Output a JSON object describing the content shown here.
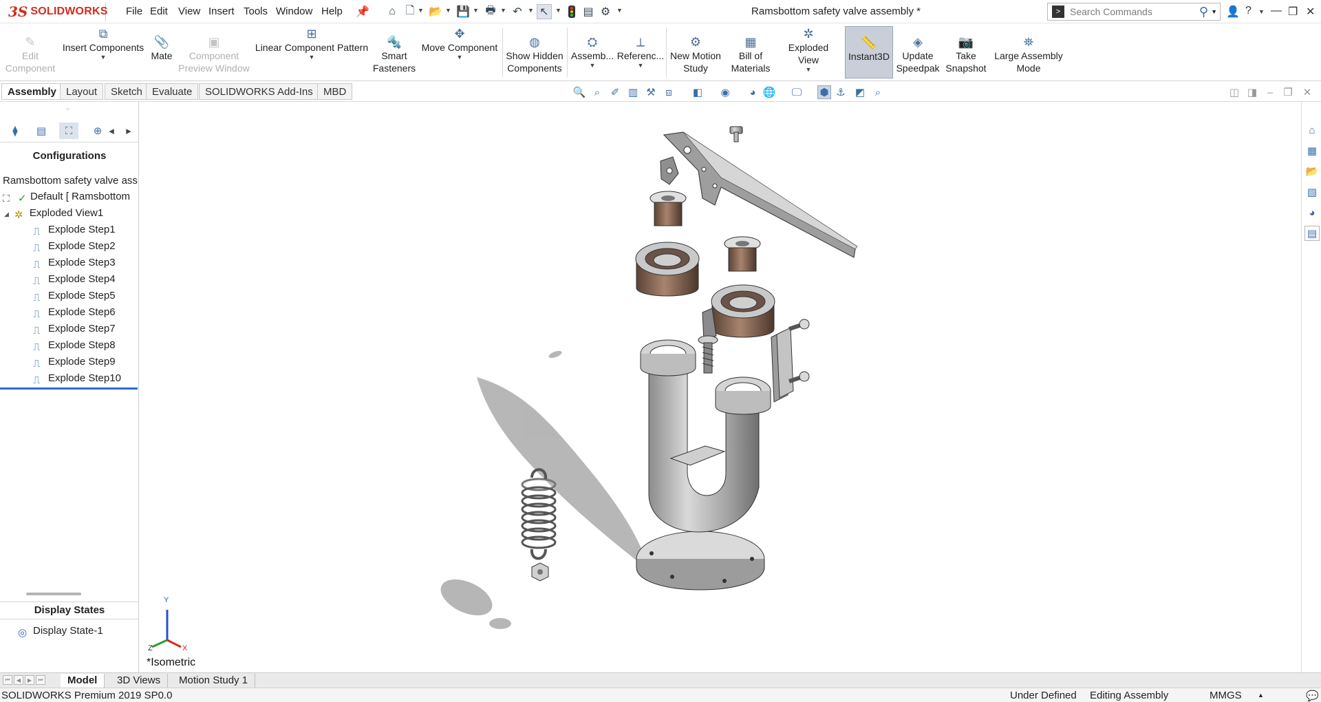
{
  "app": {
    "brand_ds": "3S",
    "brand_name": "SOLIDWORKS",
    "document_title": "Ramsbottom safety valve assembly *"
  },
  "menu": [
    "File",
    "Edit",
    "View",
    "Insert",
    "Tools",
    "Window",
    "Help"
  ],
  "search": {
    "placeholder": "Search Commands"
  },
  "commands": {
    "edit_component": "Edit Component",
    "insert_components": "Insert Components",
    "mate": "Mate",
    "component_preview_window": "Component Preview Window",
    "linear_component_pattern": "Linear Component Pattern",
    "smart_fasteners": "Smart Fasteners",
    "move_component": "Move Component",
    "show_hidden_components": "Show Hidden Components",
    "assembly_features": "Assemb...",
    "reference_geometry": "Referenc...",
    "new_motion_study": "New Motion Study",
    "bill_of_materials": "Bill of Materials",
    "exploded_view": "Exploded View",
    "instant3d": "Instant3D",
    "update_speedpak": "Update Speedpak",
    "take_snapshot": "Take Snapshot",
    "large_assembly_mode": "Large Assembly Mode"
  },
  "cm_tabs": [
    "Assembly",
    "Layout",
    "Sketch",
    "Evaluate",
    "SOLIDWORKS Add-Ins",
    "MBD"
  ],
  "config_panel": {
    "header": "Configurations",
    "root": "Ramsbottom safety valve asse",
    "default_config": "Default [ Ramsbottom",
    "exploded_view": "Exploded View1",
    "steps": [
      "Explode Step1",
      "Explode Step2",
      "Explode Step3",
      "Explode Step4",
      "Explode Step5",
      "Explode Step6",
      "Explode Step7",
      "Explode Step8",
      "Explode Step9",
      "Explode Step10"
    ],
    "display_states_header": "Display States",
    "display_state": "Display State-1"
  },
  "viewport": {
    "view_label": "*Isometric",
    "axis_y": "Y",
    "axis_x": "X",
    "axis_z": "Z"
  },
  "bottom_tabs": [
    "Model",
    "3D Views",
    "Motion Study 1"
  ],
  "status": {
    "product": "SOLIDWORKS Premium 2019 SP0.0",
    "definition": "Under Defined",
    "mode": "Editing Assembly",
    "units": "MMGS"
  },
  "colors": {
    "brand_red": "#d52b1e",
    "active_button": "#c9cfd8",
    "selection_blue": "#2a6ad6"
  }
}
